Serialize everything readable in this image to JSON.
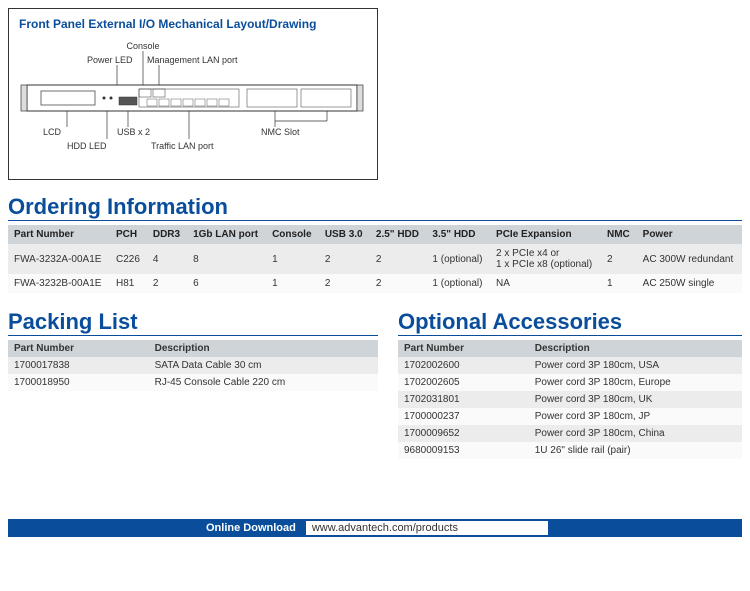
{
  "diagram": {
    "title": "Front Panel External I/O Mechanical Layout/Drawing",
    "labels": {
      "console": "Console",
      "powerLed": "Power LED",
      "mgmtLan": "Management LAN port",
      "lcd": "LCD",
      "usb": "USB x 2",
      "hddLed": "HDD LED",
      "trafficLan": "Traffic LAN port",
      "nmcSlot": "NMC Slot"
    }
  },
  "sections": {
    "ordering": "Ordering Information",
    "packing": "Packing List",
    "accessories": "Optional Accessories"
  },
  "orderingHeaders": [
    "Part Number",
    "PCH",
    "DDR3",
    "1Gb LAN port",
    "Console",
    "USB 3.0",
    "2.5\" HDD",
    "3.5\" HDD",
    "PCIe Expansion",
    "NMC",
    "Power"
  ],
  "orderingRows": [
    {
      "pn": "FWA-3232A-00A1E",
      "pch": "C226",
      "ddr3": "4",
      "lan": "8",
      "console": "1",
      "usb": "2",
      "hdd25": "2",
      "hdd35": "1 (optional)",
      "pcie": "2 x PCIe x4 or\n1 x PCIe x8 (optional)",
      "nmc": "2",
      "power": "AC 300W redundant"
    },
    {
      "pn": "FWA-3232B-00A1E",
      "pch": "H81",
      "ddr3": "2",
      "lan": "6",
      "console": "1",
      "usb": "2",
      "hdd25": "2",
      "hdd35": "1 (optional)",
      "pcie": "NA",
      "nmc": "1",
      "power": "AC 250W single"
    }
  ],
  "packingHeaders": [
    "Part Number",
    "Description"
  ],
  "packingRows": [
    {
      "pn": "1700017838",
      "desc": "SATA Data Cable 30 cm"
    },
    {
      "pn": "1700018950",
      "desc": "RJ-45 Console Cable 220 cm"
    }
  ],
  "accHeaders": [
    "Part Number",
    "Description"
  ],
  "accRows": [
    {
      "pn": "1702002600",
      "desc": "Power cord 3P 180cm, USA"
    },
    {
      "pn": "1702002605",
      "desc": "Power cord 3P 180cm, Europe"
    },
    {
      "pn": "1702031801",
      "desc": "Power cord 3P 180cm, UK"
    },
    {
      "pn": "1700000237",
      "desc": "Power cord 3P 180cm, JP"
    },
    {
      "pn": "1700009652",
      "desc": "Power cord 3P 180cm, China"
    },
    {
      "pn": "9680009153",
      "desc": "1U 26\" slide rail (pair)"
    }
  ],
  "footer": {
    "label": "Online Download",
    "url": "www.advantech.com/products"
  }
}
